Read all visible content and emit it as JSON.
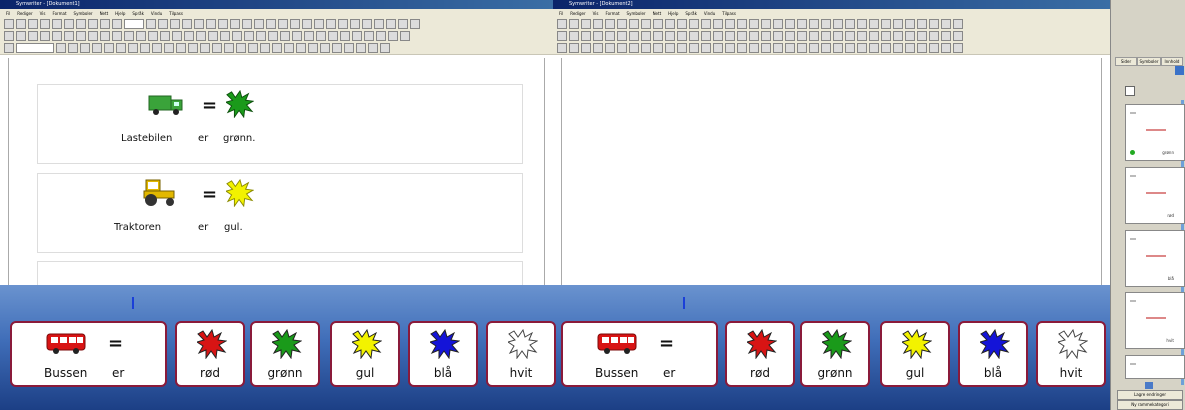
{
  "left_window": {
    "title": "Symwriter - [Dokument1]",
    "menu": [
      "Fil",
      "Rediger",
      "Vis",
      "Format",
      "Symboler",
      "Nett",
      "Hjelp",
      "Språk",
      "Vindu",
      "Tilpass"
    ],
    "rows": [
      {
        "caption": [
          "Lastebilen",
          "er",
          "grønn."
        ],
        "color": "#1a9a1a"
      },
      {
        "caption": [
          "Traktoren",
          "er",
          "gul."
        ],
        "color": "#f2f200"
      }
    ]
  },
  "right_window": {
    "title": "Symwriter - [Dokument2]",
    "menu": [
      "Fil",
      "Rediger",
      "Vis",
      "Format",
      "Symboler",
      "Nett",
      "Hjelp",
      "Språk",
      "Vindu",
      "Tilpass"
    ]
  },
  "sidebar": {
    "tabs": [
      "Sider",
      "Symboler",
      "Innhold"
    ],
    "thumb_tags": [
      "grønn",
      "rød",
      "blå",
      "hvit",
      ""
    ],
    "buttons": [
      "Lagre endringer",
      "Ny rammekategori"
    ]
  },
  "strip": {
    "equals": "=",
    "cards": [
      {
        "type": "sentence",
        "word1": "Bussen",
        "word2": "er"
      },
      {
        "type": "color",
        "label": "rød",
        "color": "#d81414"
      },
      {
        "type": "color",
        "label": "grønn",
        "color": "#1a9a1a"
      },
      {
        "type": "color",
        "label": "gul",
        "color": "#f2f200"
      },
      {
        "type": "color",
        "label": "blå",
        "color": "#1414d8"
      },
      {
        "type": "color",
        "label": "hvit",
        "color": "#ffffff"
      },
      {
        "type": "sentence",
        "word1": "Bussen",
        "word2": "er"
      },
      {
        "type": "color",
        "label": "rød",
        "color": "#d81414"
      },
      {
        "type": "color",
        "label": "grønn",
        "color": "#1a9a1a"
      },
      {
        "type": "color",
        "label": "gul",
        "color": "#f2f200"
      },
      {
        "type": "color",
        "label": "blå",
        "color": "#1414d8"
      },
      {
        "type": "color",
        "label": "hvit",
        "color": "#ffffff"
      }
    ]
  }
}
